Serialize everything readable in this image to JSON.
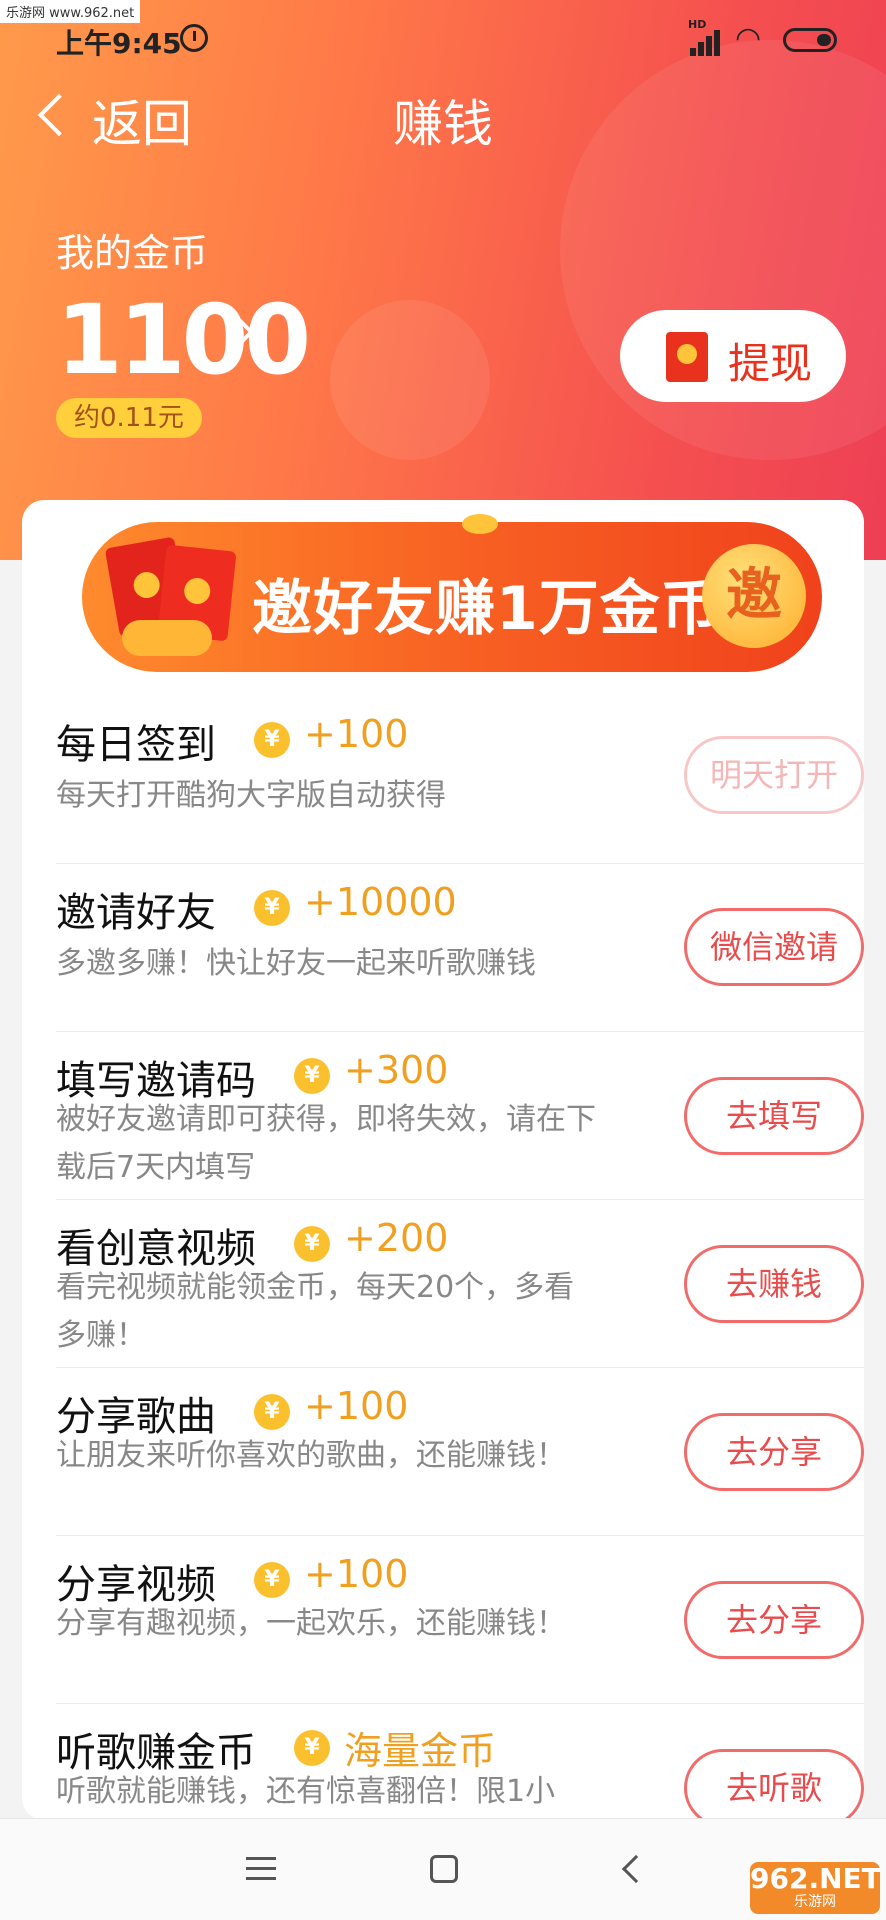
{
  "watermark": {
    "top": "乐游网 www.962.net",
    "bottom_main": "962.NET",
    "bottom_sub": "乐游网"
  },
  "status_bar": {
    "time": "上午9:45",
    "network": "HD"
  },
  "nav": {
    "back_label": "返回",
    "title": "赚钱"
  },
  "coins": {
    "label": "我的金币",
    "value": "1100",
    "yuan": "约0.11元"
  },
  "withdraw": {
    "label": "提现"
  },
  "banner": {
    "text": "邀好友赚1万金币",
    "badge": "邀"
  },
  "coin_symbol": "¥",
  "tasks": [
    {
      "name": "每日签到",
      "reward": "+100",
      "desc": "每天打开酷狗大字版自动获得",
      "button": "明天打开",
      "disabled": true
    },
    {
      "name": "邀请好友",
      "reward": "+10000",
      "desc": "多邀多赚！快让好友一起来听歌赚钱",
      "button": "微信邀请",
      "disabled": false
    },
    {
      "name": "填写邀请码",
      "reward": "+300",
      "desc": "被好友邀请即可获得，即将失效，请在下载后7天内填写",
      "button": "去填写",
      "disabled": false
    },
    {
      "name": "看创意视频",
      "reward": "+200",
      "desc": "看完视频就能领金币，每天20个，多看多赚！",
      "button": "去赚钱",
      "disabled": false
    },
    {
      "name": "分享歌曲",
      "reward": "+100",
      "desc": "让朋友来听你喜欢的歌曲，还能赚钱！",
      "button": "去分享",
      "disabled": false
    },
    {
      "name": "分享视频",
      "reward": "+100",
      "desc": "分享有趣视频，一起欢乐，还能赚钱！",
      "button": "去分享",
      "disabled": false
    },
    {
      "name": "听歌赚金币",
      "reward": "海量金币",
      "desc": "听歌就能赚钱，还有惊喜翻倍！限1小",
      "button": "去听歌",
      "disabled": false
    }
  ],
  "colors": {
    "accent": "#e84b4b",
    "coin": "#fbc02d",
    "reward": "#f0a020",
    "yuan_badge": "#ffcf3c"
  }
}
